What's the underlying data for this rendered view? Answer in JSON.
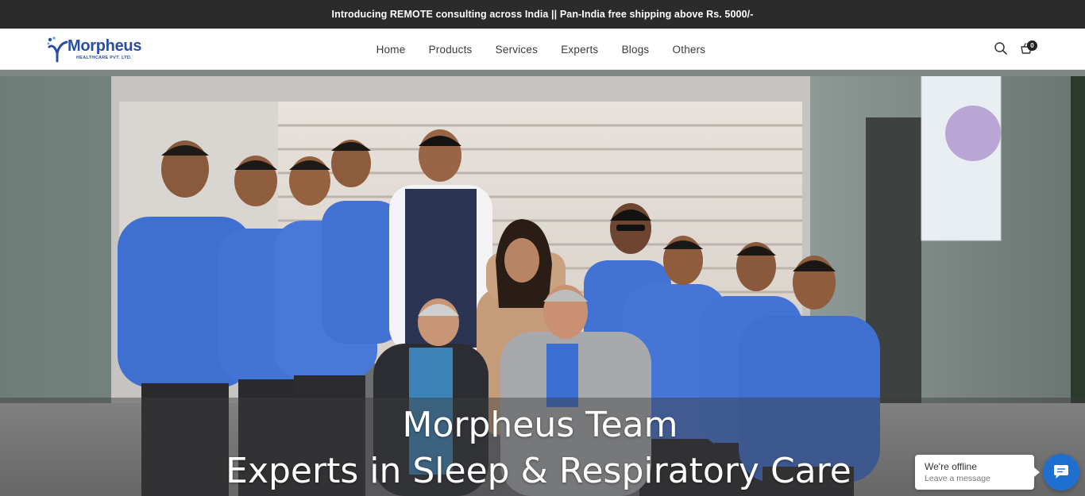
{
  "announcement": "Introducing REMOTE consulting across India || Pan-India free shipping above Rs. 5000/-",
  "brand": {
    "name": "Morpheus",
    "tagline": "HEALTHCARE PVT. LTD."
  },
  "nav": {
    "items": [
      "Home",
      "Products",
      "Services",
      "Experts",
      "Blogs",
      "Others"
    ]
  },
  "header_icons": {
    "search": "search-icon",
    "cart": "cart-icon",
    "cart_count": "0"
  },
  "hero": {
    "line1": "Morpheus Team",
    "line2": "Experts in Sleep & Respiratory Care"
  },
  "chat": {
    "status": "We're offline",
    "action": "Leave a message",
    "icon": "chat-icon",
    "accent": "#1e6fcf"
  },
  "colors": {
    "announce_bg": "#2b2b2b",
    "brand_blue": "#2a4ea0",
    "sweater_blue": "#3f6fd1"
  }
}
